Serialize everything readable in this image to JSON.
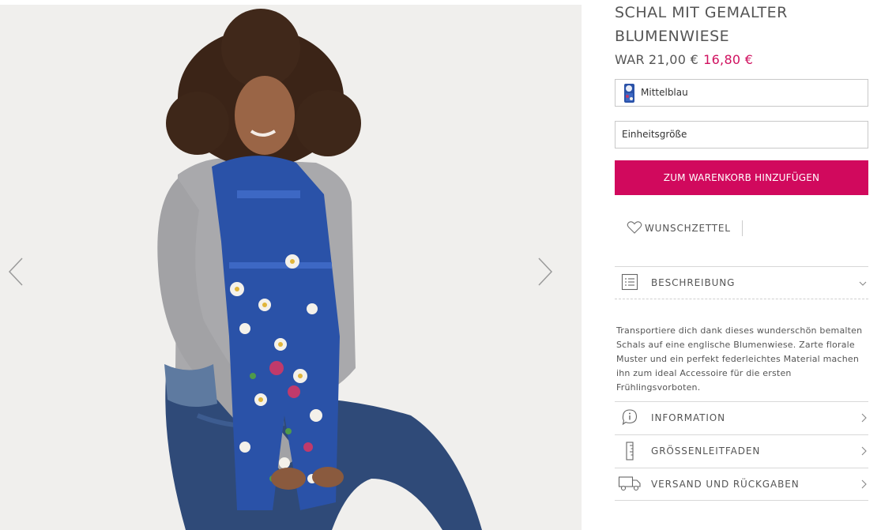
{
  "product": {
    "title": "SCHAL MIT GEMALTER BLUMENWIESE",
    "price_prefix": "WAR",
    "was_price": "21,00 €",
    "sale_price": "16,80 €",
    "color_value": "Mittelblau",
    "size_value": "Einheitsgröße",
    "add_to_cart_label": "ZUM WARENKORB HINZUFÜGEN",
    "wishlist_label": "WUNSCHZETTEL"
  },
  "accordion": {
    "description_label": "BESCHREIBUNG",
    "description_text": "Transportiere dich dank dieses wunderschön bemalten Schals auf eine englische Blumenwiese. Zarte florale Muster und ein perfekt federleichtes Material machen ihn zum ideal Accessoire für die ersten Frühlingsvorboten.",
    "information_label": "INFORMATION",
    "size_guide_label": "GRÖSSENLEITFADEN",
    "shipping_label": "VERSAND UND RÜCKGABEN"
  },
  "colors": {
    "accent": "#d1095d",
    "sale_price": "#d0105f",
    "scarf_blue": "#2a52a8",
    "photo_background": "#f0efed"
  },
  "icons": {
    "gallery_prev": "chevron-left-icon",
    "gallery_next": "chevron-right-icon",
    "wishlist": "heart-icon",
    "description": "list-icon",
    "information": "info-icon",
    "size_guide": "ruler-icon",
    "shipping": "truck-icon",
    "expand": "chevron-down-icon",
    "open": "chevron-right-icon"
  }
}
